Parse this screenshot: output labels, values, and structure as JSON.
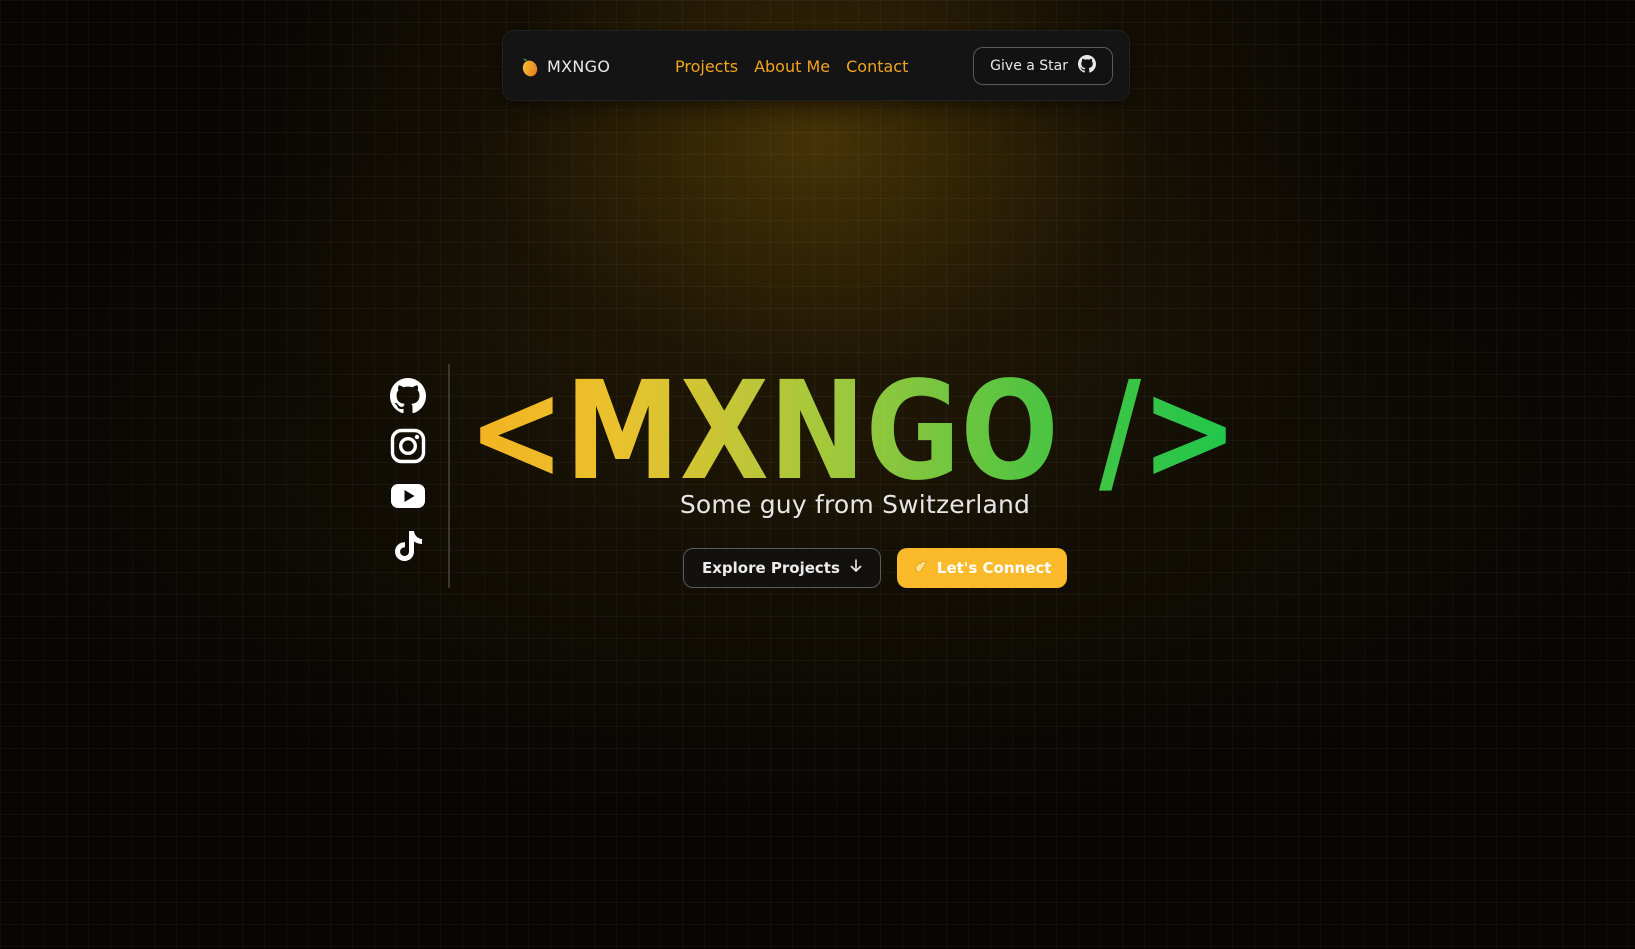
{
  "nav": {
    "brand": "MXNGO",
    "brand_icon": "mango-icon",
    "links": [
      {
        "label": "Projects"
      },
      {
        "label": "About Me"
      },
      {
        "label": "Contact"
      }
    ],
    "star_button": {
      "label": "Give a Star",
      "icon": "github-icon"
    }
  },
  "hero": {
    "title": "<MXNGO />",
    "title_gradient": [
      "#f5b321",
      "#e9c22e",
      "#a8c83c",
      "#4cc442",
      "#1fc64c"
    ],
    "subtitle": "Some guy from Switzerland",
    "explore_button": {
      "label": "Explore Projects",
      "icon": "arrow-down-icon"
    },
    "connect_button": {
      "label": "Let's Connect",
      "icon": "wave-hand-icon"
    }
  },
  "socials": [
    {
      "name": "github",
      "icon": "github-icon"
    },
    {
      "name": "instagram",
      "icon": "instagram-icon"
    },
    {
      "name": "youtube",
      "icon": "youtube-icon"
    },
    {
      "name": "tiktok",
      "icon": "tiktok-icon"
    }
  ],
  "colors": {
    "accent": "#f2a41f",
    "primary_button": "#fbba2a",
    "nav_bg": "#141414"
  }
}
